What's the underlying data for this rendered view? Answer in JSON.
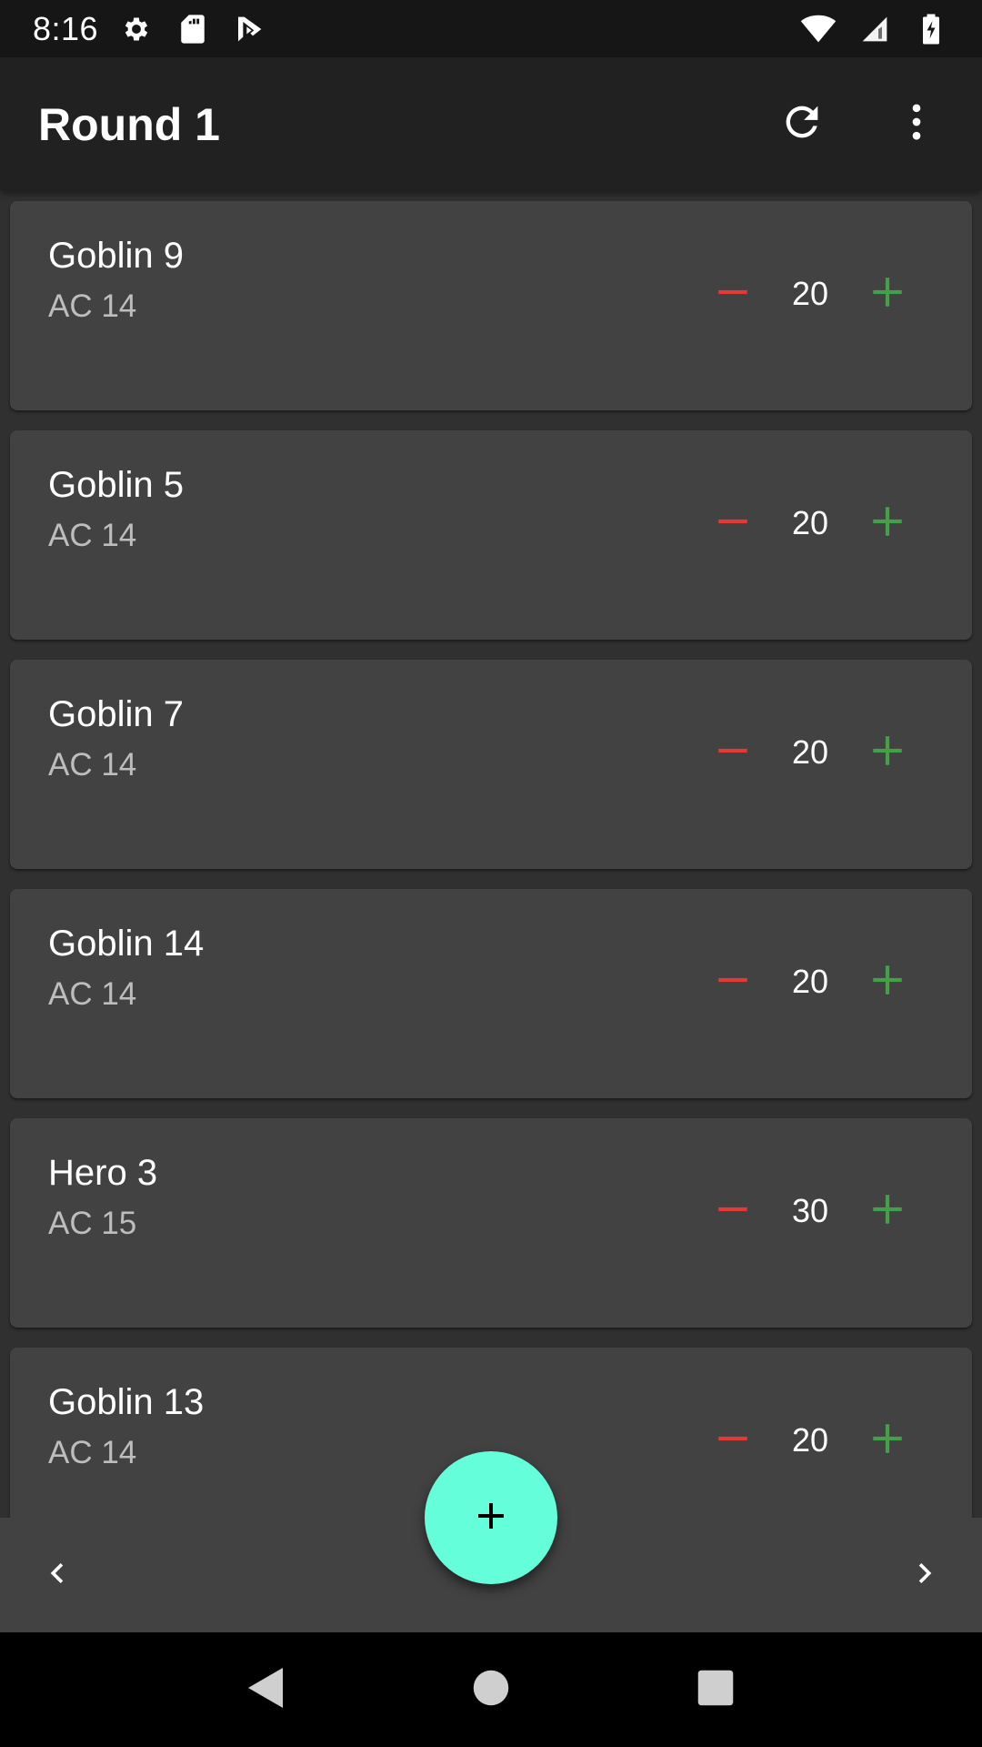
{
  "status_bar": {
    "time": "8:16",
    "icons": [
      "settings-icon",
      "sd-card-icon",
      "play-store-icon",
      "wifi-icon",
      "signal-icon",
      "battery-charging-icon"
    ]
  },
  "app_bar": {
    "title": "Round 1",
    "actions": [
      "refresh-icon",
      "more-vert-icon"
    ]
  },
  "combatants": [
    {
      "name": "Goblin 9",
      "ac": "AC 14",
      "hp": "20"
    },
    {
      "name": "Goblin 5",
      "ac": "AC 14",
      "hp": "20"
    },
    {
      "name": "Goblin 7",
      "ac": "AC 14",
      "hp": "20"
    },
    {
      "name": "Goblin 14",
      "ac": "AC 14",
      "hp": "20"
    },
    {
      "name": "Hero 3",
      "ac": "AC 15",
      "hp": "30"
    },
    {
      "name": "Goblin 13",
      "ac": "AC 14",
      "hp": "20"
    }
  ],
  "colors": {
    "decrement": "#e53935",
    "increment": "#43a047",
    "fab": "#64ffda",
    "card": "#424242",
    "background": "#303030"
  },
  "bottom_bar": {
    "prev_icon": "chevron-left-icon",
    "next_icon": "chevron-right-icon",
    "fab_icon": "add-icon"
  },
  "system_nav": [
    "back-icon",
    "home-icon",
    "recents-icon"
  ]
}
